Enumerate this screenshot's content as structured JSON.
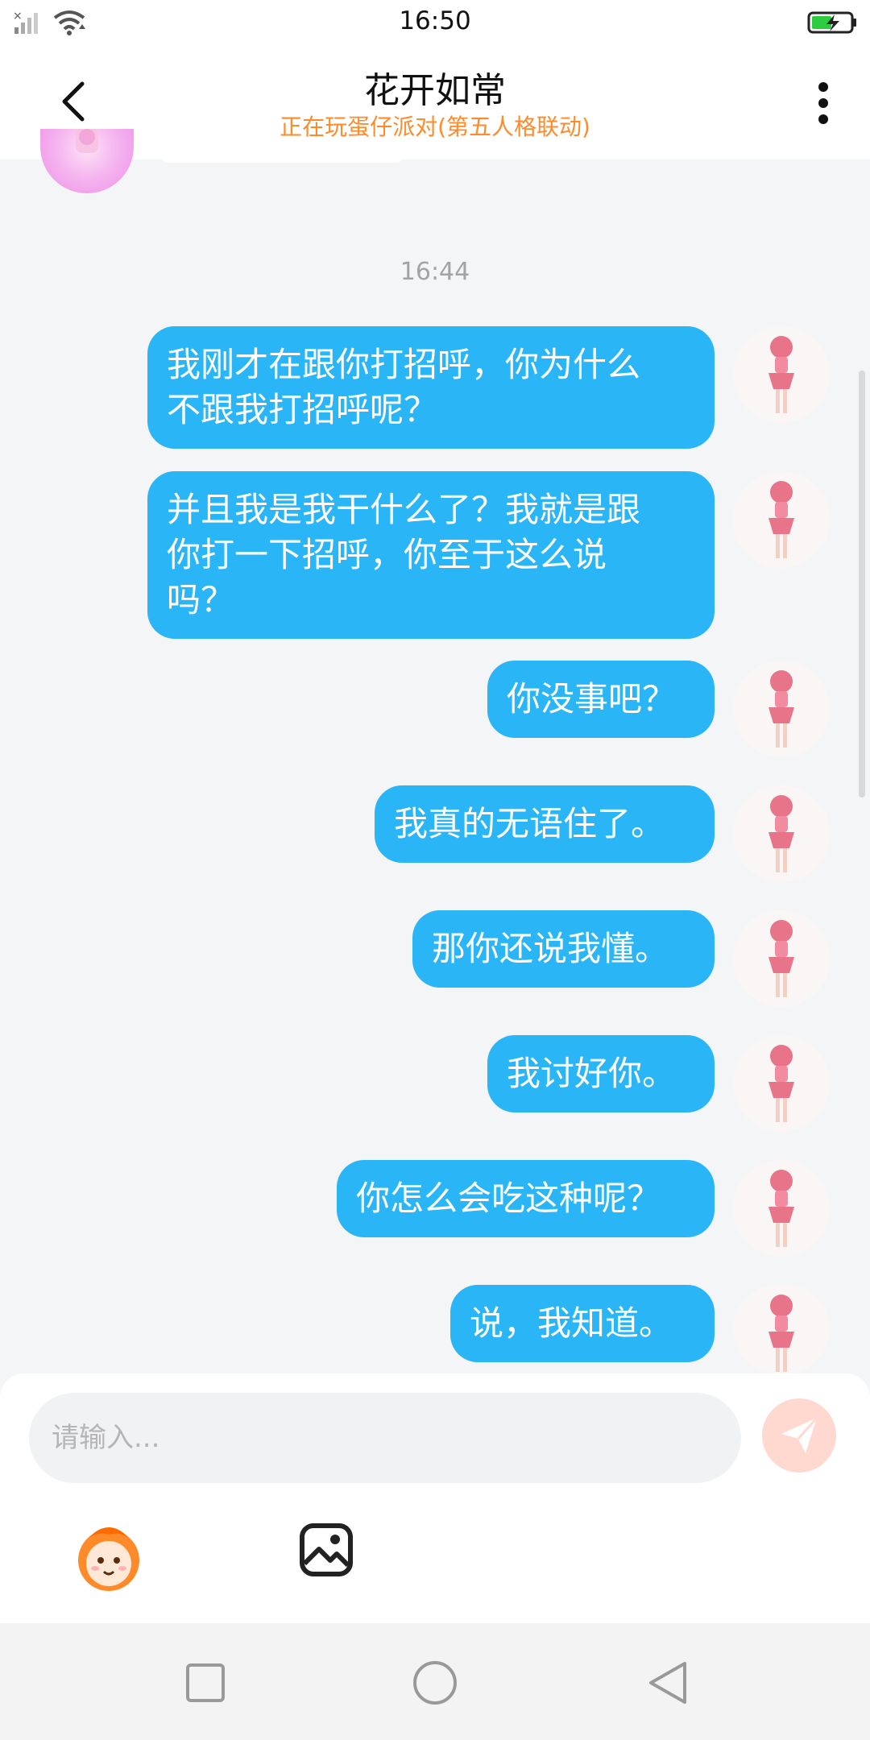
{
  "status_bar": {
    "time": "16:50",
    "icons": [
      "signal-icon",
      "wifi-icon",
      "battery-charging-icon"
    ]
  },
  "header": {
    "title": "花开如常",
    "subtitle": "正在玩蛋仔派对(第五人格联动)",
    "back_icon": "chevron-left-icon",
    "more_icon": "more-vertical-icon"
  },
  "chat": {
    "timestamp": "16:44",
    "messages": [
      {
        "text": "我刚才在跟你打招呼，你为什么\n不跟我打招呼呢？"
      },
      {
        "text": "并且我是我干什么了？我就是跟\n你打一下招呼，你至于这么说\n吗？"
      },
      {
        "text": "你没事吧？"
      },
      {
        "text": "我真的无语住了。"
      },
      {
        "text": "那你还说我懂。"
      },
      {
        "text": "我讨好你。"
      },
      {
        "text": "你怎么会吃这种呢？"
      },
      {
        "text": "说，我知道。"
      }
    ]
  },
  "input": {
    "placeholder": "请输入...",
    "send_icon": "send-icon",
    "tools": [
      "emoji-icon",
      "image-icon"
    ]
  },
  "nav_bar": {
    "buttons": [
      "square-recents-icon",
      "circle-home-icon",
      "triangle-back-icon"
    ]
  },
  "colors": {
    "bubble": "#2ab5f7",
    "subtitle": "#ff8a2a",
    "background": "#f4f5f7"
  }
}
